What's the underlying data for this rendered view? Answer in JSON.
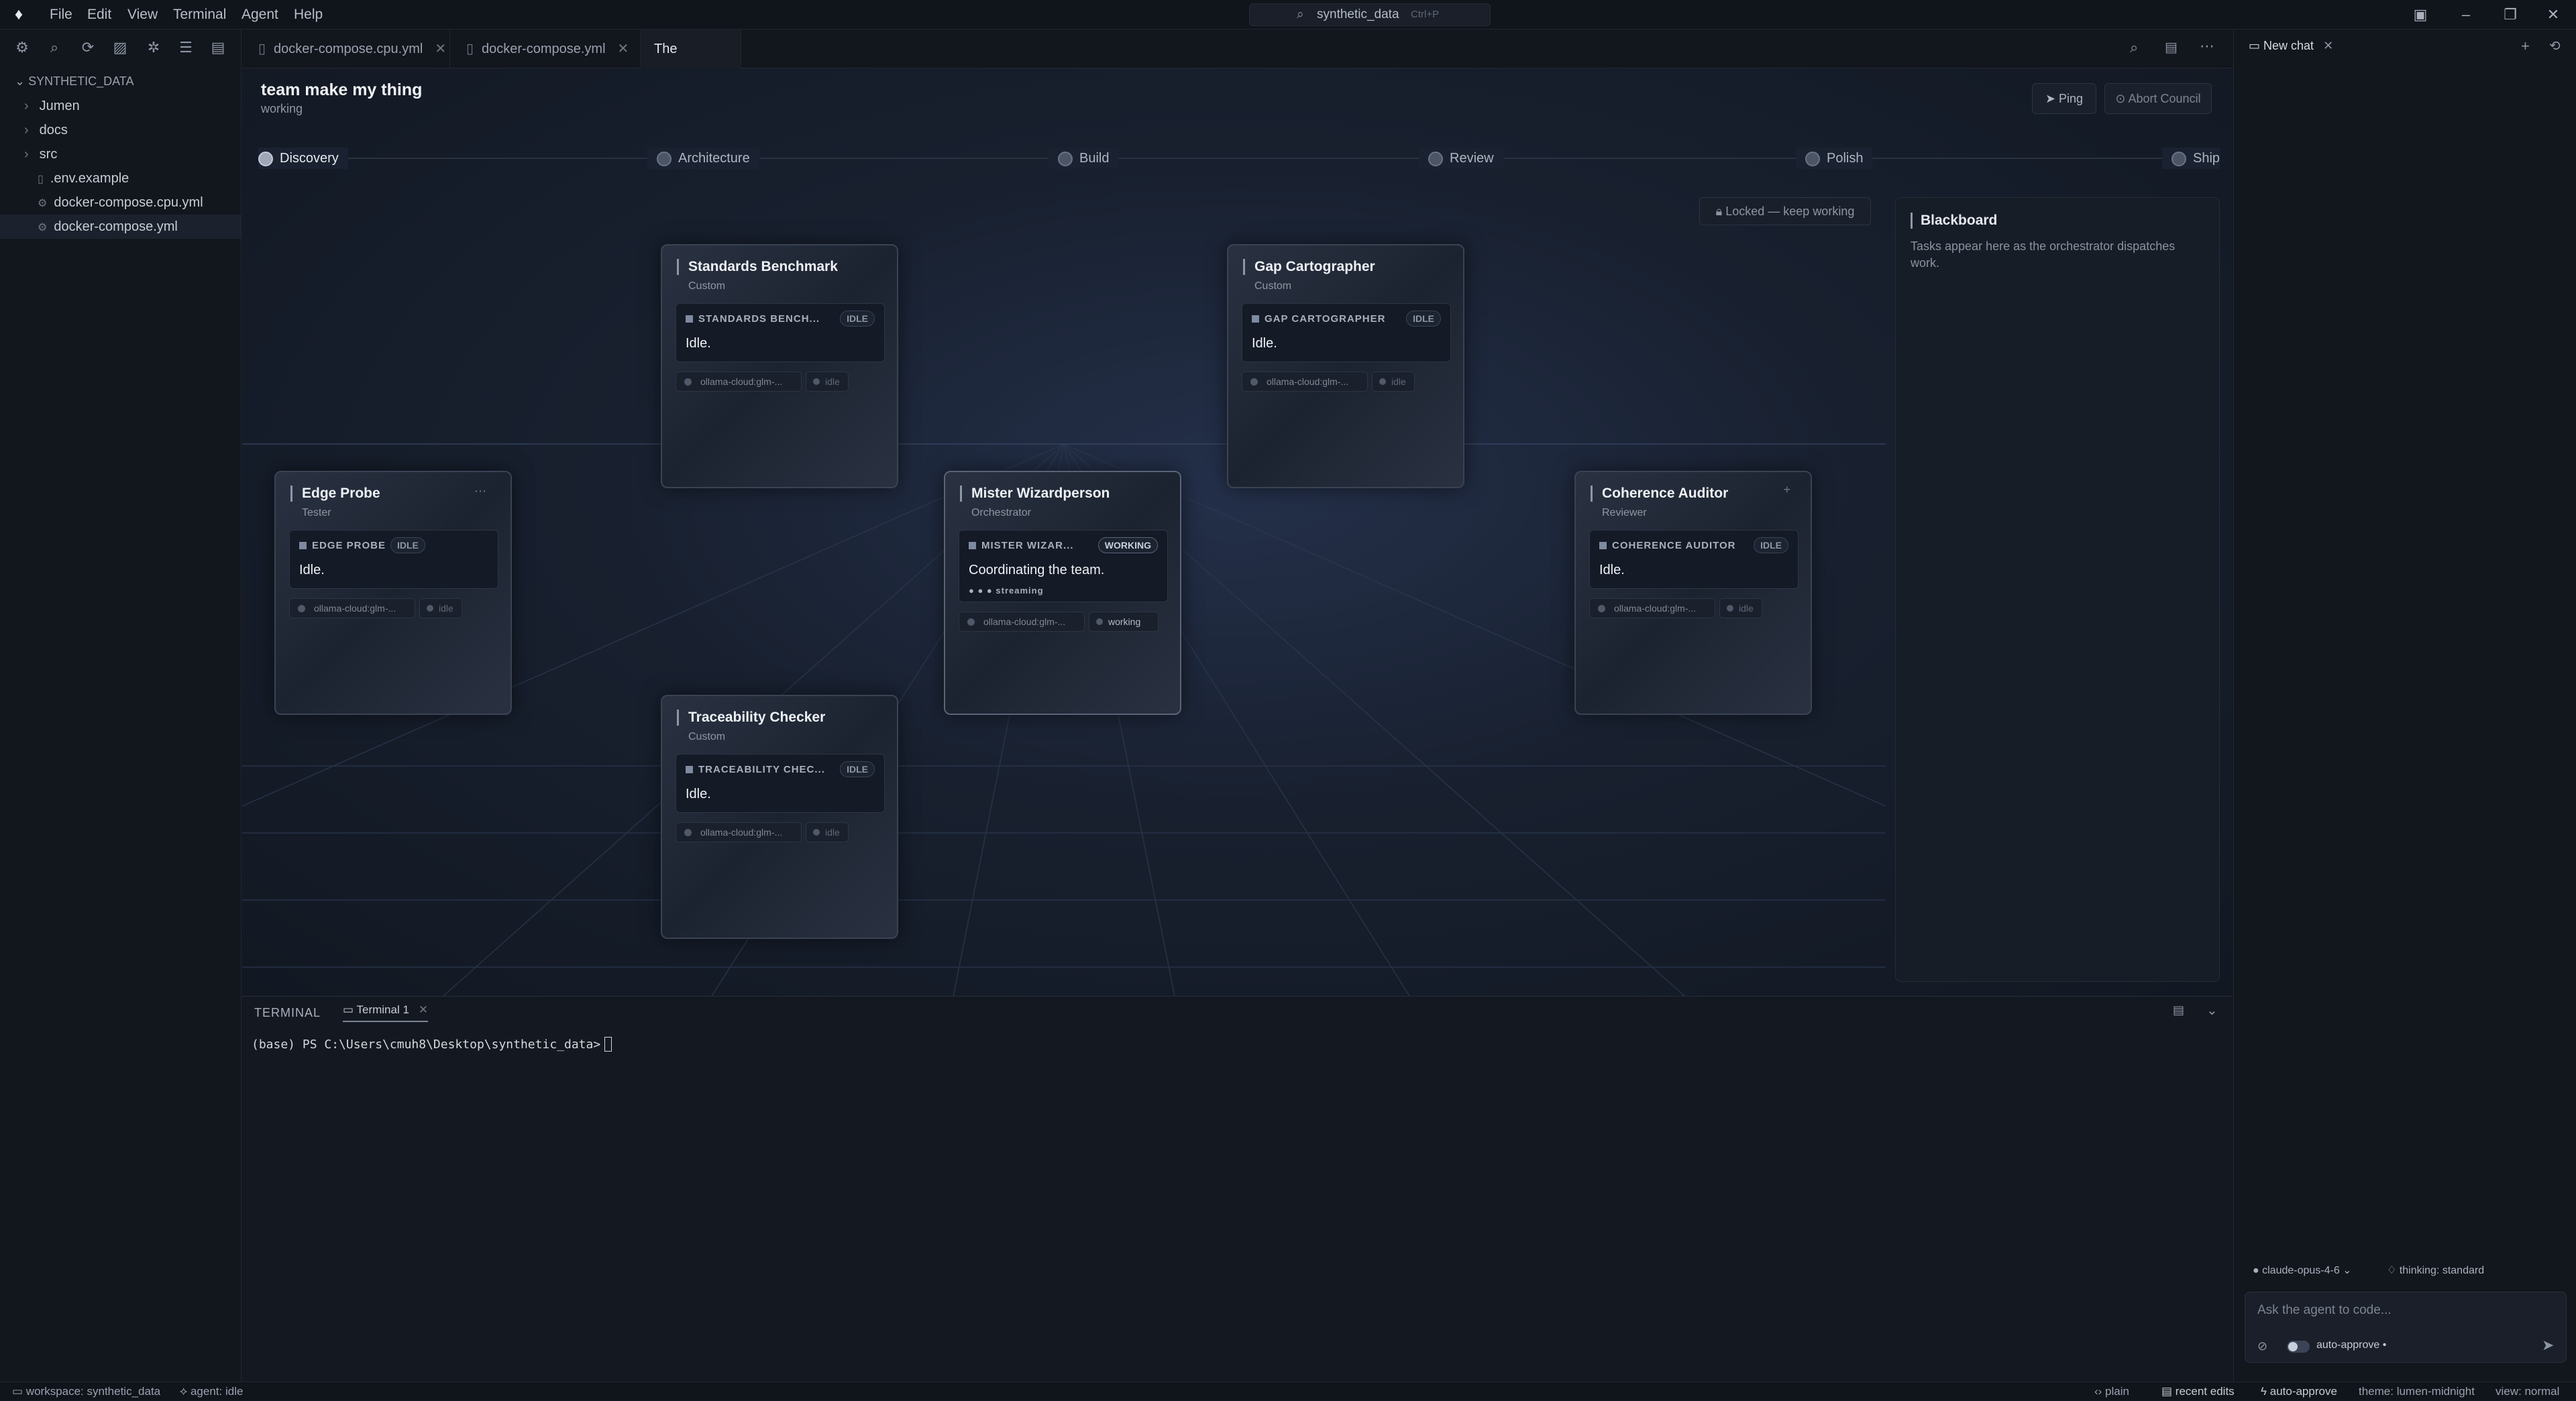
{
  "titlebar": {
    "menu": [
      "File",
      "Edit",
      "View",
      "Terminal",
      "Agent",
      "Help"
    ],
    "search_text": "synthetic_data",
    "search_shortcut": "Ctrl+P"
  },
  "sidebar": {
    "root": "SYNTHETIC_DATA",
    "items": [
      {
        "label": "Jumen",
        "type": "folder"
      },
      {
        "label": "docs",
        "type": "folder"
      },
      {
        "label": "src",
        "type": "folder"
      },
      {
        "label": ".env.example",
        "type": "file"
      },
      {
        "label": "docker-compose.cpu.yml",
        "type": "file"
      },
      {
        "label": "docker-compose.yml",
        "type": "file"
      }
    ]
  },
  "tabs": [
    {
      "label": "docker-compose.cpu.yml"
    },
    {
      "label": "docker-compose.yml"
    },
    {
      "label": "The Council"
    }
  ],
  "council": {
    "title": "team make my thing",
    "status": "working",
    "ping_label": "Ping",
    "abort_label": "Abort Council",
    "lock_label": "Locked — keep working",
    "steps": [
      "Discovery",
      "Architecture",
      "Build",
      "Review",
      "Polish",
      "Ship"
    ],
    "blackboard_title": "Blackboard",
    "blackboard_text": "Tasks appear here as the orchestrator dispatches work.",
    "agents": [
      {
        "name": "Standards Benchmark",
        "role": "Custom",
        "agent_label": "STANDARDS BENCH...",
        "badge": "IDLE",
        "status": "Idle.",
        "model": "ollama-cloud:glm-...",
        "model_state": "idle"
      },
      {
        "name": "Gap Cartographer",
        "role": "Custom",
        "agent_label": "GAP CARTOGRAPHER",
        "badge": "IDLE",
        "status": "Idle.",
        "model": "ollama-cloud:glm-...",
        "model_state": "idle"
      },
      {
        "name": "Edge Probe",
        "role": "Tester",
        "agent_label": "EDGE PROBE",
        "badge": "IDLE",
        "status": "Idle.",
        "model": "ollama-cloud:glm-...",
        "model_state": "idle"
      },
      {
        "name": "Mister Wizardperson",
        "role": "Orchestrator",
        "agent_label": "MISTER WIZAR...",
        "badge": "WORKING",
        "status": "Coordinating the team.",
        "stream": "streaming",
        "model": "ollama-cloud:glm-...",
        "model_state": "working"
      },
      {
        "name": "Coherence Auditor",
        "role": "Reviewer",
        "agent_label": "COHERENCE AUDITOR",
        "badge": "IDLE",
        "status": "Idle.",
        "model": "ollama-cloud:glm-...",
        "model_state": "idle"
      },
      {
        "name": "Traceability Checker",
        "role": "Custom",
        "agent_label": "TRACEABILITY CHEC...",
        "badge": "IDLE",
        "status": "Idle.",
        "model": "ollama-cloud:glm-...",
        "model_state": "idle"
      }
    ]
  },
  "terminal": {
    "header": "TERMINAL",
    "tab": "Terminal 1",
    "prompt": "(base) PS C:\\Users\\cmuh8\\Desktop\\synthetic_data>"
  },
  "chat": {
    "tab": "New chat",
    "model": "claude-opus-4-6",
    "thinking": "thinking: standard",
    "placeholder": "Ask the agent to code...",
    "auto_approve": "auto-approve •"
  },
  "statusbar": {
    "workspace": "workspace: synthetic_data",
    "agent": "agent: idle",
    "plain": "plain",
    "recent": "recent edits",
    "auto_approve": "auto-approve",
    "theme": "theme: lumen-midnight",
    "view": "view: normal"
  },
  "colors": {
    "background": "#13171f",
    "panel": "#12161d",
    "accent": "#8f98a8"
  }
}
